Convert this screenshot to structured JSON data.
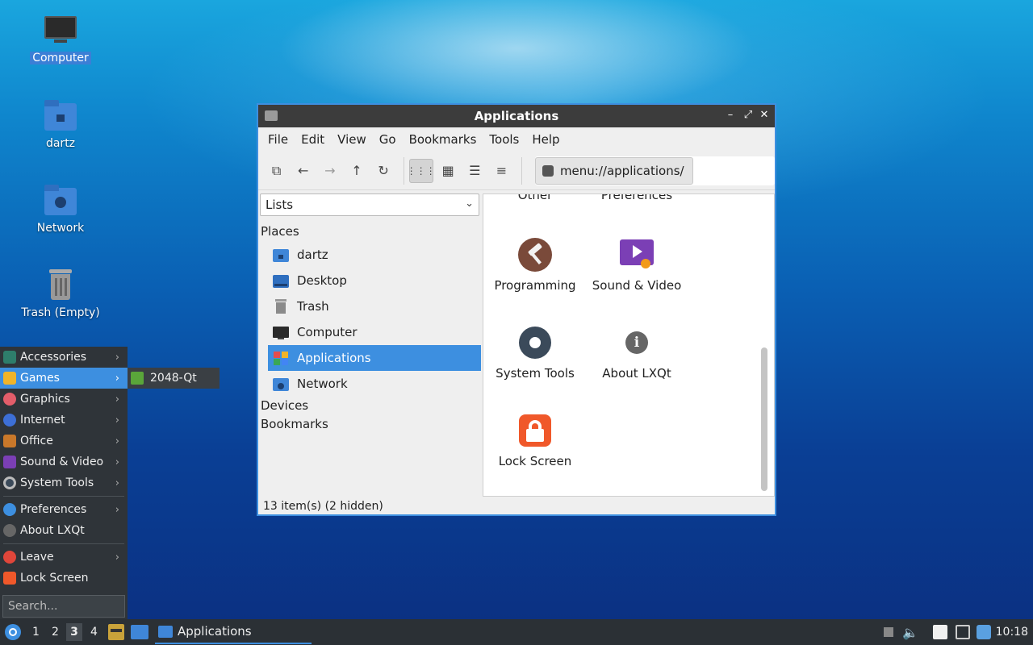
{
  "desktop": {
    "icons": [
      {
        "label": "Computer"
      },
      {
        "label": "dartz"
      },
      {
        "label": "Network"
      },
      {
        "label": "Trash (Empty)"
      }
    ]
  },
  "window": {
    "title": "Applications",
    "menu": [
      "File",
      "Edit",
      "View",
      "Go",
      "Bookmarks",
      "Tools",
      "Help"
    ],
    "path": "menu://applications/",
    "sidebar": {
      "combo": "Lists",
      "places_header": "Places",
      "places": [
        "dartz",
        "Desktop",
        "Trash",
        "Computer",
        "Applications",
        "Network"
      ],
      "devices": "Devices",
      "bookmarks": "Bookmarks"
    },
    "items": {
      "top_left_partial": "Other",
      "top_right_partial": "Preferences",
      "programming": "Programming",
      "sound_video": "Sound & Video",
      "system_tools": "System Tools",
      "about": "About LXQt",
      "lock": "Lock Screen"
    },
    "status": "13 item(s) (2 hidden)"
  },
  "startmenu": {
    "items": [
      "Accessories",
      "Games",
      "Graphics",
      "Internet",
      "Office",
      "Sound & Video",
      "System Tools",
      "Preferences",
      "About LXQt",
      "Leave",
      "Lock Screen"
    ],
    "search_placeholder": "Search...",
    "submenu_item": "2048-Qt"
  },
  "taskbar": {
    "workspaces": [
      "1",
      "2",
      "3",
      "4"
    ],
    "active_app": "Applications",
    "clock": "10:18"
  },
  "colors": {
    "accent": "#3d8fe0",
    "titlebar": "#3c3c3c",
    "panel": "#2b3035"
  }
}
